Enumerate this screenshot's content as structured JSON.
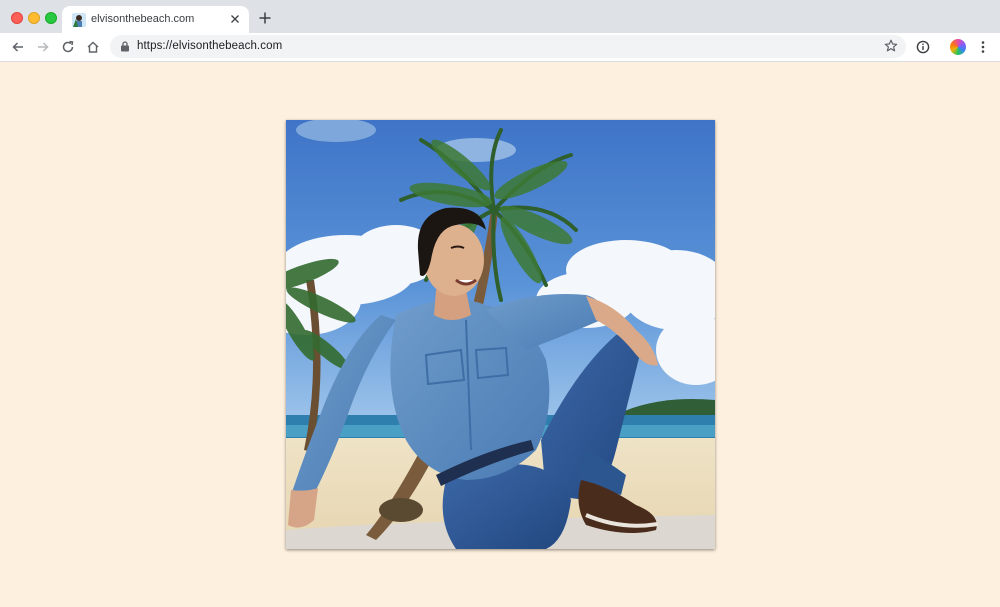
{
  "browser": {
    "tab": {
      "title": "elvisonthebeach.com",
      "favicon": "elvis-favicon-icon"
    },
    "address_bar": {
      "url": "https://elvisonthebeach.com"
    },
    "icons": {
      "back": "back-arrow-icon",
      "forward": "forward-arrow-icon",
      "reload": "reload-icon",
      "home": "home-icon",
      "lock": "lock-icon",
      "bookmark": "star-icon",
      "info": "info-icon",
      "menu": "kebab-menu-icon",
      "new_tab": "plus-icon",
      "close_tab": "close-icon"
    }
  },
  "page": {
    "background_color": "#fef0de",
    "image": {
      "alt": "Elvis Presley in denim shirt and jeans sitting on a tropical beach with palm trees",
      "subject": "elvis-on-beach-photo"
    }
  }
}
